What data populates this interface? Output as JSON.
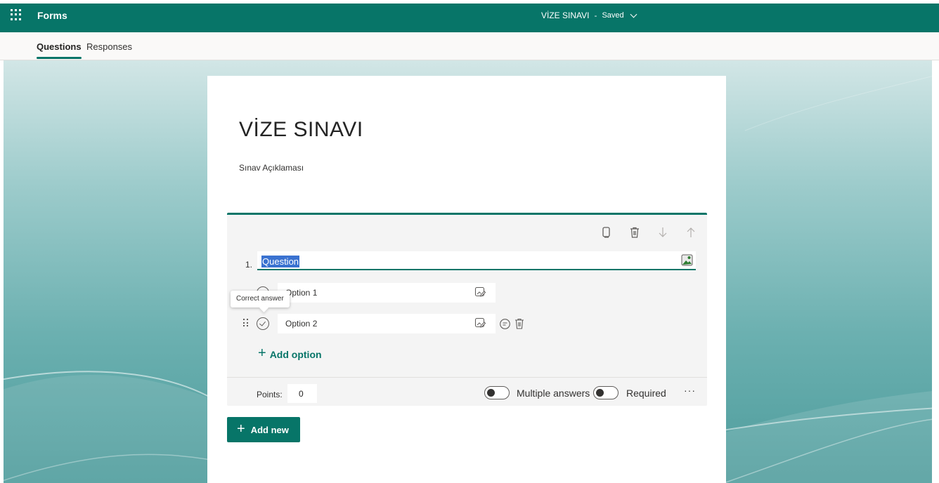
{
  "app": {
    "name": "Forms"
  },
  "document": {
    "title": "VİZE SINAVI",
    "separator": "-",
    "status": "Saved"
  },
  "tabs": [
    {
      "label": "Questions",
      "active": true
    },
    {
      "label": "Responses",
      "active": false
    }
  ],
  "form": {
    "title": "VİZE SINAVI",
    "description": "Sınav Açıklaması"
  },
  "question": {
    "number": "1.",
    "text": "Question",
    "tools": [
      "copy-icon",
      "delete-icon",
      "move-down-icon",
      "move-up-icon"
    ],
    "options": [
      {
        "label": "Option 1"
      },
      {
        "label": "Option 2"
      }
    ],
    "tooltip": "Correct answer",
    "add_option_label": "Add option",
    "points_label": "Points:",
    "points_value": "0",
    "multiple_answers_label": "Multiple answers",
    "required_label": "Required",
    "more_label": "···"
  },
  "add_new_label": "Add new",
  "colors": {
    "accent": "#077568",
    "selection": "#3a72d0"
  }
}
